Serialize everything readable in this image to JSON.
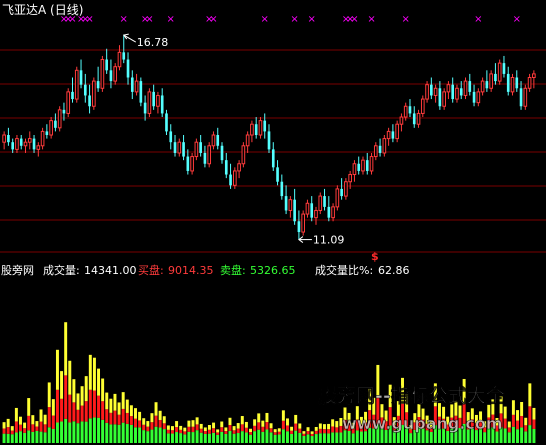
{
  "colors": {
    "bg": "#000000",
    "up": "#ff3b3b",
    "down": "#54ffff",
    "grid": "#7a0000",
    "marker": "#ff00ff",
    "label": "#ffffff",
    "buy": "#ff3b3b",
    "sell": "#34ff34",
    "vol_top": "#ffff33",
    "vol_mid": "#ff1a1a",
    "vol_low": "#34ff34",
    "watermark": "#b0b0b0",
    "signal": "#ff2a2a"
  },
  "header": {
    "title": "飞亚达A (日线)"
  },
  "price_panel": {
    "high_label": "16.78",
    "low_label": "11.09",
    "signal_glyph": "$",
    "marker_glyph": "×"
  },
  "volume_panel": {
    "site": "股旁网",
    "vol_label": "成交量:",
    "vol_value": "14341.00",
    "buy_label": "买盘:",
    "buy_value": "9014.35",
    "sell_label": "卖盘:",
    "sell_value": "5326.65",
    "ratio_label": "成交量比%:",
    "ratio_value": "62.86"
  },
  "watermark": {
    "line1": "股旁网--指标公式大全",
    "line2": "www.gupang.com"
  },
  "chart_data": [
    {
      "type": "candlestick",
      "title": "飞亚达A (日线)",
      "ylim": [
        10.8,
        17.2
      ],
      "annotations": [
        {
          "text": "16.78",
          "value": 16.78,
          "kind": "high"
        },
        {
          "text": "11.09",
          "value": 11.09,
          "kind": "low"
        }
      ],
      "ohlc": [
        [
          13.8,
          14.1,
          13.6,
          14.0
        ],
        [
          14.0,
          14.2,
          13.7,
          13.8
        ],
        [
          13.8,
          13.9,
          13.5,
          13.6
        ],
        [
          13.6,
          14.0,
          13.5,
          13.9
        ],
        [
          13.9,
          14.0,
          13.6,
          13.7
        ],
        [
          13.7,
          13.9,
          13.5,
          13.8
        ],
        [
          13.8,
          14.1,
          13.6,
          13.9
        ],
        [
          13.9,
          14.0,
          13.5,
          13.6
        ],
        [
          13.6,
          13.8,
          13.4,
          13.7
        ],
        [
          13.7,
          14.2,
          13.6,
          14.1
        ],
        [
          14.1,
          14.3,
          13.9,
          14.0
        ],
        [
          14.0,
          14.5,
          13.9,
          14.4
        ],
        [
          14.4,
          14.6,
          14.1,
          14.2
        ],
        [
          14.2,
          14.8,
          14.1,
          14.7
        ],
        [
          14.7,
          14.9,
          14.4,
          14.6
        ],
        [
          14.6,
          15.3,
          14.5,
          15.2
        ],
        [
          15.2,
          15.6,
          14.9,
          15.0
        ],
        [
          15.0,
          15.9,
          14.9,
          15.8
        ],
        [
          15.8,
          16.1,
          15.3,
          15.4
        ],
        [
          15.4,
          15.7,
          14.9,
          15.1
        ],
        [
          15.1,
          15.4,
          14.6,
          14.8
        ],
        [
          14.8,
          15.6,
          14.7,
          15.5
        ],
        [
          15.5,
          15.9,
          15.2,
          15.3
        ],
        [
          15.3,
          16.2,
          15.2,
          16.1
        ],
        [
          16.1,
          16.4,
          15.7,
          15.8
        ],
        [
          15.8,
          16.1,
          15.3,
          15.5
        ],
        [
          15.5,
          16.0,
          15.4,
          15.9
        ],
        [
          15.9,
          16.5,
          15.8,
          16.3
        ],
        [
          16.3,
          16.78,
          16.0,
          16.1
        ],
        [
          16.1,
          16.3,
          15.4,
          15.6
        ],
        [
          15.6,
          15.8,
          15.0,
          15.2
        ],
        [
          15.2,
          15.7,
          15.1,
          15.5
        ],
        [
          15.5,
          15.6,
          14.8,
          14.9
        ],
        [
          14.9,
          15.1,
          14.4,
          14.6
        ],
        [
          14.6,
          15.3,
          14.5,
          15.2
        ],
        [
          15.2,
          15.4,
          14.7,
          14.8
        ],
        [
          14.8,
          15.2,
          14.6,
          15.1
        ],
        [
          15.1,
          15.3,
          14.5,
          14.6
        ],
        [
          14.6,
          14.7,
          14.0,
          14.1
        ],
        [
          14.1,
          14.3,
          13.6,
          13.8
        ],
        [
          13.8,
          14.0,
          13.4,
          13.5
        ],
        [
          13.5,
          13.9,
          13.4,
          13.8
        ],
        [
          13.8,
          14.0,
          13.3,
          13.4
        ],
        [
          13.4,
          13.6,
          12.9,
          13.0
        ],
        [
          13.0,
          13.5,
          12.9,
          13.4
        ],
        [
          13.4,
          13.9,
          13.3,
          13.8
        ],
        [
          13.8,
          14.0,
          13.4,
          13.5
        ],
        [
          13.5,
          13.7,
          13.1,
          13.2
        ],
        [
          13.2,
          13.8,
          13.1,
          13.7
        ],
        [
          13.7,
          14.1,
          13.6,
          14.0
        ],
        [
          14.0,
          14.2,
          13.6,
          13.7
        ],
        [
          13.7,
          13.8,
          13.2,
          13.3
        ],
        [
          13.3,
          13.5,
          12.8,
          12.9
        ],
        [
          12.9,
          13.2,
          12.5,
          12.6
        ],
        [
          12.6,
          13.1,
          12.5,
          13.0
        ],
        [
          13.0,
          13.3,
          12.8,
          13.2
        ],
        [
          13.2,
          13.8,
          13.1,
          13.7
        ],
        [
          13.7,
          14.1,
          13.5,
          14.0
        ],
        [
          14.0,
          14.4,
          13.8,
          14.3
        ],
        [
          14.3,
          14.5,
          13.9,
          14.0
        ],
        [
          14.0,
          14.5,
          13.9,
          14.4
        ],
        [
          14.4,
          14.6,
          13.9,
          14.1
        ],
        [
          14.1,
          14.3,
          13.5,
          13.6
        ],
        [
          13.6,
          13.8,
          13.0,
          13.1
        ],
        [
          13.1,
          13.3,
          12.6,
          12.7
        ],
        [
          12.7,
          12.9,
          12.2,
          12.3
        ],
        [
          12.3,
          12.6,
          11.8,
          11.9
        ],
        [
          11.9,
          12.3,
          11.7,
          12.2
        ],
        [
          12.2,
          12.5,
          11.5,
          11.6
        ],
        [
          11.6,
          11.9,
          11.09,
          11.3
        ],
        [
          11.3,
          11.9,
          11.2,
          11.8
        ],
        [
          11.8,
          12.2,
          11.7,
          12.1
        ],
        [
          12.1,
          12.3,
          11.6,
          11.7
        ],
        [
          11.7,
          12.0,
          11.5,
          11.9
        ],
        [
          11.9,
          12.4,
          11.8,
          12.3
        ],
        [
          12.3,
          12.5,
          11.9,
          12.0
        ],
        [
          12.0,
          12.3,
          11.6,
          11.7
        ],
        [
          11.7,
          12.1,
          11.6,
          12.0
        ],
        [
          12.0,
          12.6,
          11.9,
          12.5
        ],
        [
          12.5,
          12.8,
          12.2,
          12.3
        ],
        [
          12.3,
          12.8,
          12.2,
          12.7
        ],
        [
          12.7,
          13.0,
          12.5,
          12.9
        ],
        [
          12.9,
          13.3,
          12.7,
          13.2
        ],
        [
          13.2,
          13.4,
          12.9,
          13.0
        ],
        [
          13.0,
          13.4,
          12.9,
          13.3
        ],
        [
          13.3,
          13.5,
          12.9,
          13.0
        ],
        [
          13.0,
          13.5,
          12.9,
          13.4
        ],
        [
          13.4,
          13.8,
          13.3,
          13.7
        ],
        [
          13.7,
          13.9,
          13.4,
          13.5
        ],
        [
          13.5,
          14.0,
          13.4,
          13.9
        ],
        [
          13.9,
          14.2,
          13.7,
          14.1
        ],
        [
          14.1,
          14.3,
          13.8,
          13.9
        ],
        [
          13.9,
          14.4,
          13.8,
          14.3
        ],
        [
          14.3,
          14.6,
          14.1,
          14.5
        ],
        [
          14.5,
          14.9,
          14.4,
          14.8
        ],
        [
          14.8,
          15.0,
          14.5,
          14.6
        ],
        [
          14.6,
          14.8,
          14.2,
          14.3
        ],
        [
          14.3,
          14.7,
          14.2,
          14.6
        ],
        [
          14.6,
          15.1,
          14.5,
          15.0
        ],
        [
          15.0,
          15.5,
          14.9,
          15.4
        ],
        [
          15.4,
          15.6,
          15.0,
          15.1
        ],
        [
          15.1,
          15.4,
          14.9,
          15.3
        ],
        [
          15.3,
          15.5,
          14.7,
          14.8
        ],
        [
          14.8,
          15.3,
          14.7,
          15.2
        ],
        [
          15.2,
          15.5,
          15.0,
          15.4
        ],
        [
          15.4,
          15.6,
          14.9,
          15.0
        ],
        [
          15.0,
          15.4,
          14.9,
          15.3
        ],
        [
          15.3,
          15.5,
          15.0,
          15.1
        ],
        [
          15.1,
          15.6,
          15.0,
          15.5
        ],
        [
          15.5,
          15.7,
          15.1,
          15.2
        ],
        [
          15.2,
          15.4,
          14.8,
          14.9
        ],
        [
          14.9,
          15.3,
          14.8,
          15.2
        ],
        [
          15.2,
          15.6,
          15.1,
          15.5
        ],
        [
          15.5,
          15.8,
          15.2,
          15.3
        ],
        [
          15.3,
          15.8,
          15.2,
          15.7
        ],
        [
          15.7,
          16.0,
          15.4,
          15.5
        ],
        [
          15.5,
          16.1,
          15.4,
          16.0
        ],
        [
          16.0,
          16.2,
          15.6,
          15.7
        ],
        [
          15.7,
          15.9,
          15.1,
          15.2
        ],
        [
          15.2,
          15.7,
          15.1,
          15.6
        ],
        [
          15.6,
          15.8,
          15.2,
          15.3
        ],
        [
          15.3,
          15.5,
          14.7,
          14.8
        ],
        [
          14.8,
          15.4,
          14.7,
          15.3
        ],
        [
          15.3,
          15.7,
          15.2,
          15.6
        ],
        [
          15.6,
          15.8,
          15.3,
          15.7
        ]
      ],
      "markers_top_index": [
        14,
        15,
        16,
        18,
        19,
        20,
        28,
        33,
        34,
        39,
        48,
        49,
        61,
        68,
        72,
        80,
        81,
        82,
        86,
        94,
        111,
        120,
        131
      ]
    },
    {
      "type": "bar",
      "title": "成交量",
      "legend": [
        "买盘",
        "卖盘"
      ],
      "ylim": [
        0,
        14341
      ],
      "values": [
        1855,
        2148,
        1504,
        3124,
        2343,
        1816,
        4003,
        2480,
        1953,
        2988,
        2519,
        5394,
        3906,
        8302,
        6403,
        10759,
        7325,
        5684,
        4414,
        5059,
        5956,
        7852,
        7598,
        6626,
        5743,
        4492,
        3945,
        4375,
        3612,
        4531,
        3867,
        3359,
        3105,
        2773,
        2207,
        1954,
        2656,
        3633,
        2871,
        2384,
        1562,
        1504,
        1953,
        1523,
        1367,
        1992,
        2031,
        2285,
        1699,
        1386,
        1601,
        1816,
        1211,
        1914,
        1387,
        2246,
        1504,
        1777,
        2402,
        1875,
        1270,
        2109,
        2637,
        1992,
        2676,
        1758,
        1231,
        1309,
        2910,
        2188,
        1446,
        2500,
        1739,
        1055,
        1406,
        1035,
        1426,
        1738,
        1680,
        1699,
        2109,
        1953,
        2227,
        3164,
        2676,
        1797,
        3281,
        2324,
        2774,
        4844,
        4023,
        6953,
        3457,
        2891,
        5195,
        2304,
        3730,
        5801,
        4297,
        1602,
        2657,
        3457,
        3066,
        2442,
        1973,
        5312,
        3555,
        3223,
        2344,
        3437,
        3750,
        3340,
        5703,
        2754,
        3086,
        2500,
        2813,
        1934,
        3398,
        3907,
        2227,
        4141,
        3243,
        1914,
        3809,
        2930,
        3652,
        2246,
        5312,
        3125
      ],
      "buy_fraction": [
        0.55,
        0.62,
        0.48,
        0.7,
        0.55,
        0.5,
        0.72,
        0.6,
        0.45,
        0.66,
        0.62,
        0.74,
        0.68,
        0.78,
        0.7,
        0.8,
        0.75,
        0.66,
        0.6,
        0.62,
        0.68,
        0.72,
        0.7,
        0.66,
        0.64,
        0.6,
        0.58,
        0.62,
        0.55,
        0.6,
        0.56,
        0.52,
        0.55,
        0.5,
        0.48,
        0.46,
        0.55,
        0.6,
        0.52,
        0.48,
        0.45,
        0.44,
        0.5,
        0.42,
        0.44,
        0.5,
        0.52,
        0.5,
        0.46,
        0.42,
        0.48,
        0.5,
        0.4,
        0.48,
        0.42,
        0.52,
        0.45,
        0.5,
        0.56,
        0.5,
        0.42,
        0.5,
        0.55,
        0.5,
        0.55,
        0.46,
        0.4,
        0.42,
        0.58,
        0.52,
        0.44,
        0.56,
        0.48,
        0.4,
        0.45,
        0.4,
        0.44,
        0.5,
        0.48,
        0.5,
        0.55,
        0.52,
        0.58,
        0.64,
        0.6,
        0.52,
        0.66,
        0.56,
        0.62,
        0.72,
        0.68,
        0.76,
        0.62,
        0.6,
        0.7,
        0.55,
        0.64,
        0.72,
        0.66,
        0.45,
        0.56,
        0.6,
        0.58,
        0.54,
        0.5,
        0.7,
        0.62,
        0.6,
        0.54,
        0.62,
        0.64,
        0.6,
        0.7,
        0.56,
        0.58,
        0.54,
        0.56,
        0.5,
        0.6,
        0.64,
        0.54,
        0.66,
        0.6,
        0.5,
        0.62,
        0.58,
        0.62,
        0.54,
        0.7,
        0.6
      ]
    }
  ]
}
